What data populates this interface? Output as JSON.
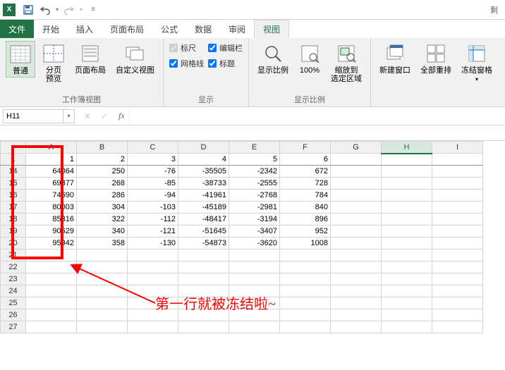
{
  "titlebar": {
    "right_text": "剩"
  },
  "tabs": {
    "file": "文件",
    "items": [
      "开始",
      "插入",
      "页面布局",
      "公式",
      "数据",
      "审阅",
      "视图"
    ],
    "active_index": 6
  },
  "ribbon": {
    "views": {
      "label": "工作簿视图",
      "normal": "普通",
      "page_break": "分页\n预览",
      "page_layout": "页面布局",
      "custom": "自定义视图"
    },
    "show": {
      "label": "显示",
      "ruler": "标尺",
      "gridlines": "网格线",
      "formula_bar": "编辑栏",
      "headings": "标题",
      "ruler_checked": true,
      "gridlines_checked": true,
      "formula_bar_checked": true,
      "headings_checked": true
    },
    "zoom": {
      "label": "显示比例",
      "zoom": "显示比例",
      "hundred": "100%",
      "to_selection": "缩放到\n选定区域"
    },
    "window": {
      "new_window": "新建窗口",
      "arrange_all": "全部重排",
      "freeze": "冻结窗格"
    }
  },
  "namebox": "H11",
  "fx_label": "fx",
  "columns": [
    "A",
    "B",
    "C",
    "D",
    "E",
    "F",
    "G",
    "H",
    "I"
  ],
  "selected_col": "H",
  "frozen_row": "1",
  "row_headers_frozen": [
    "1"
  ],
  "row_headers_scroll": [
    "14",
    "15",
    "16",
    "17",
    "18",
    "19",
    "20",
    "21",
    "22",
    "23",
    "24",
    "25",
    "26",
    "27"
  ],
  "data": {
    "1": {
      "A": "1",
      "B": "2",
      "C": "3",
      "D": "4",
      "E": "5",
      "F": "6"
    },
    "14": {
      "A": "64064",
      "B": "250",
      "C": "-76",
      "D": "-35505",
      "E": "-2342",
      "F": "672"
    },
    "15": {
      "A": "69377",
      "B": "268",
      "C": "-85",
      "D": "-38733",
      "E": "-2555",
      "F": "728"
    },
    "16": {
      "A": "74690",
      "B": "286",
      "C": "-94",
      "D": "-41961",
      "E": "-2768",
      "F": "784"
    },
    "17": {
      "A": "80003",
      "B": "304",
      "C": "-103",
      "D": "-45189",
      "E": "-2981",
      "F": "840"
    },
    "18": {
      "A": "85316",
      "B": "322",
      "C": "-112",
      "D": "-48417",
      "E": "-3194",
      "F": "896"
    },
    "19": {
      "A": "90629",
      "B": "340",
      "C": "-121",
      "D": "-51645",
      "E": "-3407",
      "F": "952"
    },
    "20": {
      "A": "95942",
      "B": "358",
      "C": "-130",
      "D": "-54873",
      "E": "-3620",
      "F": "1008"
    }
  },
  "annotation_text": "第一行就被冻结啦~",
  "chart_data": {
    "type": "table",
    "description": "Excel spreadsheet with frozen first row (row 1 with values 1-6); body rows 14-20 shown after scroll",
    "columns": [
      "A",
      "B",
      "C",
      "D",
      "E",
      "F"
    ],
    "rows": [
      {
        "row": 1,
        "A": 1,
        "B": 2,
        "C": 3,
        "D": 4,
        "E": 5,
        "F": 6
      },
      {
        "row": 14,
        "A": 64064,
        "B": 250,
        "C": -76,
        "D": -35505,
        "E": -2342,
        "F": 672
      },
      {
        "row": 15,
        "A": 69377,
        "B": 268,
        "C": -85,
        "D": -38733,
        "E": -2555,
        "F": 728
      },
      {
        "row": 16,
        "A": 74690,
        "B": 286,
        "C": -94,
        "D": -41961,
        "E": -2768,
        "F": 784
      },
      {
        "row": 17,
        "A": 80003,
        "B": 304,
        "C": -103,
        "D": -45189,
        "E": -2981,
        "F": 840
      },
      {
        "row": 18,
        "A": 85316,
        "B": 322,
        "C": -112,
        "D": -48417,
        "E": -3194,
        "F": 896
      },
      {
        "row": 19,
        "A": 90629,
        "B": 340,
        "C": -121,
        "D": -51645,
        "E": -3407,
        "F": 952
      },
      {
        "row": 20,
        "A": 95942,
        "B": 358,
        "C": -130,
        "D": -54873,
        "E": -3620,
        "F": 1008
      }
    ]
  }
}
